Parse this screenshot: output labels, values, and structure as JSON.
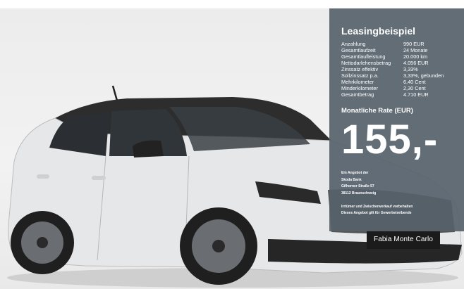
{
  "leasing": {
    "title": "Leasingbeispiel",
    "terms": [
      {
        "label": "Anzahlung",
        "value": "990 EUR"
      },
      {
        "label": "Gesamtlaufzeit",
        "value": "24 Monate"
      },
      {
        "label": "Gesamtlaufleistung",
        "value": "20.000 km"
      },
      {
        "label": "Nettodarlehensbetrag",
        "value": "4.056 EUR"
      },
      {
        "label": "Zinssatz effektiv",
        "value": "3,33%"
      },
      {
        "label": "Sollzinssatz p.a.",
        "value": "3,33%, gebunden"
      },
      {
        "label": "Mehrkilometer",
        "value": "6,40 Cent"
      },
      {
        "label": "Minderkilometer",
        "value": "2,30 Cent"
      },
      {
        "label": "Gesamtbetrag",
        "value": "4.710 EUR"
      }
    ],
    "rate_label": "Monatliche Rate (EUR)",
    "rate_value": "155,-",
    "offer_lines": [
      "Ein Angebot der",
      "Skoda Bank",
      "Gifhorner Straße 57",
      "38112 Braunschweig"
    ],
    "disclaimer_lines": [
      "Irrtümer und Zwischenverkauf vorbehalten",
      "Dieses Angebot gilt für Gewerbetreibende"
    ]
  },
  "car": {
    "plate_text": "Fabia Monte Carlo",
    "body_color": "#e9eaeb",
    "roof_color": "#2a2a2a"
  },
  "colors": {
    "panel_bg": "#56626b",
    "panel_text": "#ffffff"
  }
}
